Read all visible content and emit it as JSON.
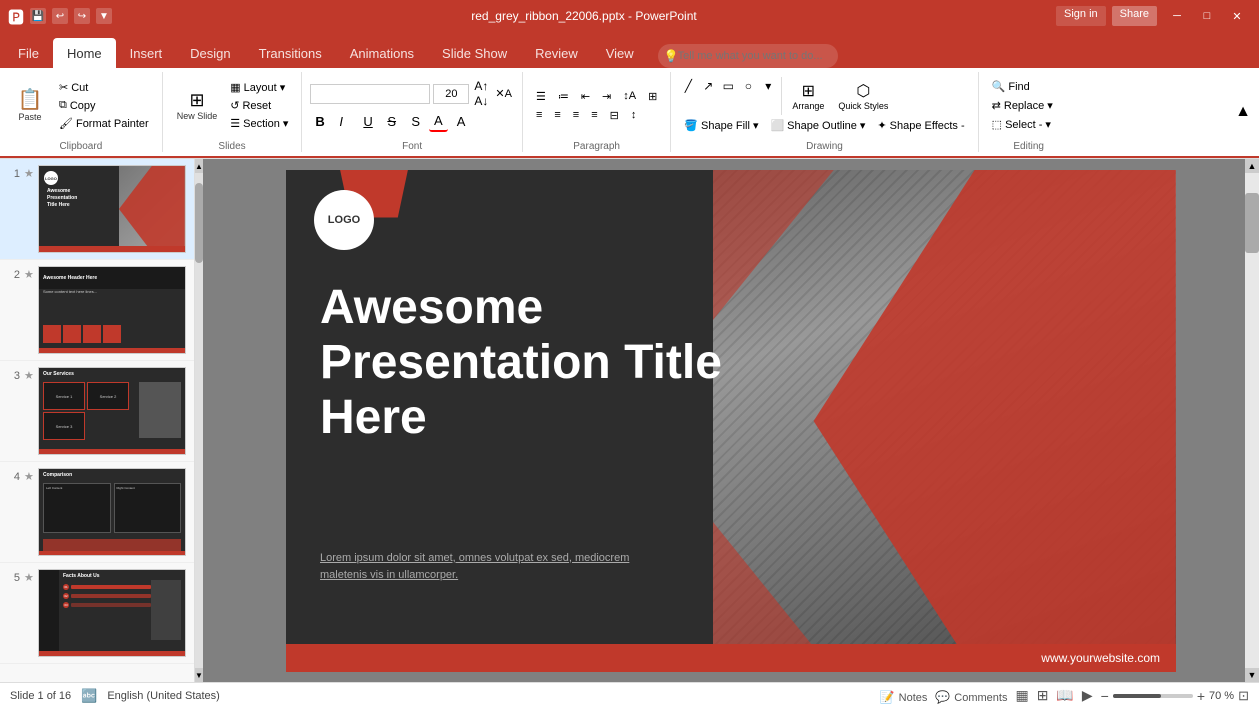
{
  "titlebar": {
    "filename": "red_grey_ribbon_22006.pptx - PowerPoint",
    "save_icon": "💾",
    "undo_icon": "↩",
    "redo_icon": "↪",
    "customize_icon": "⚙",
    "min_btn": "─",
    "max_btn": "□",
    "close_btn": "✕",
    "signin_label": "Sign in",
    "share_label": "Share"
  },
  "ribbon": {
    "tabs": [
      "File",
      "Home",
      "Insert",
      "Design",
      "Transitions",
      "Animations",
      "Slide Show",
      "Review",
      "View"
    ],
    "active_tab": "Home",
    "groups": {
      "clipboard": {
        "label": "Clipboard",
        "paste_label": "Paste",
        "cut_label": "Cut",
        "copy_label": "Copy",
        "format_painter_label": "Format Painter"
      },
      "slides": {
        "label": "Slides",
        "new_slide_label": "New Slide",
        "layout_label": "Layout",
        "reset_label": "Reset",
        "section_label": "Section"
      },
      "font": {
        "label": "Font",
        "font_name": "",
        "font_size": "20",
        "bold": "B",
        "italic": "I",
        "underline": "U",
        "strikethrough": "S",
        "shadow": "S",
        "font_color": "A"
      },
      "paragraph": {
        "label": "Paragraph",
        "align_left": "≡",
        "align_center": "≡",
        "align_right": "≡",
        "justify": "≡"
      },
      "drawing": {
        "label": "Drawing",
        "arrange_label": "Arrange",
        "quick_styles_label": "Quick Styles",
        "shape_fill_label": "Shape Fill",
        "shape_outline_label": "Shape Outline",
        "shape_effects_label": "Shape Effects -",
        "select_label": "Select -"
      },
      "editing": {
        "label": "Editing",
        "find_label": "Find",
        "replace_label": "Replace",
        "select_label": "Select"
      }
    }
  },
  "slides": [
    {
      "num": "1",
      "star": "★",
      "title": "Awesome Presentation Title Here",
      "active": true
    },
    {
      "num": "2",
      "star": "★",
      "title": "Awesome Header Here"
    },
    {
      "num": "3",
      "star": "★",
      "title": "Our Services"
    },
    {
      "num": "4",
      "star": "★",
      "title": "Comparison"
    },
    {
      "num": "5",
      "star": "★",
      "title": "Facts About Us"
    }
  ],
  "canvas": {
    "slide_title": "Awesome Presentation Title Here",
    "logo_text": "LOGO",
    "subtitle": "Lorem ipsum dolor sit amet, omnes volutpat ex sed, mediocrem maletenis vis in ullamcorper.",
    "footer_url": "www.yourwebsite.com",
    "slide_count": "Slide 1 of 16"
  },
  "statusbar": {
    "slide_info": "Slide 1 of 16",
    "language": "English (United States)",
    "notes_label": "Notes",
    "comments_label": "Comments",
    "normal_view": "▦",
    "slide_sorter": "⊞",
    "reading_view": "📖",
    "slide_show": "▶",
    "zoom_level": "70 %",
    "zoom_minus": "−",
    "zoom_plus": "+",
    "fit_btn": "⊠"
  },
  "tell_me": {
    "placeholder": "Tell me what you want to do...",
    "icon": "💡"
  },
  "colors": {
    "accent": "#c0392b",
    "dark_bg": "#2d2d2d",
    "ribbon_bg": "#ffffff",
    "tab_active_bg": "#ffffff"
  }
}
